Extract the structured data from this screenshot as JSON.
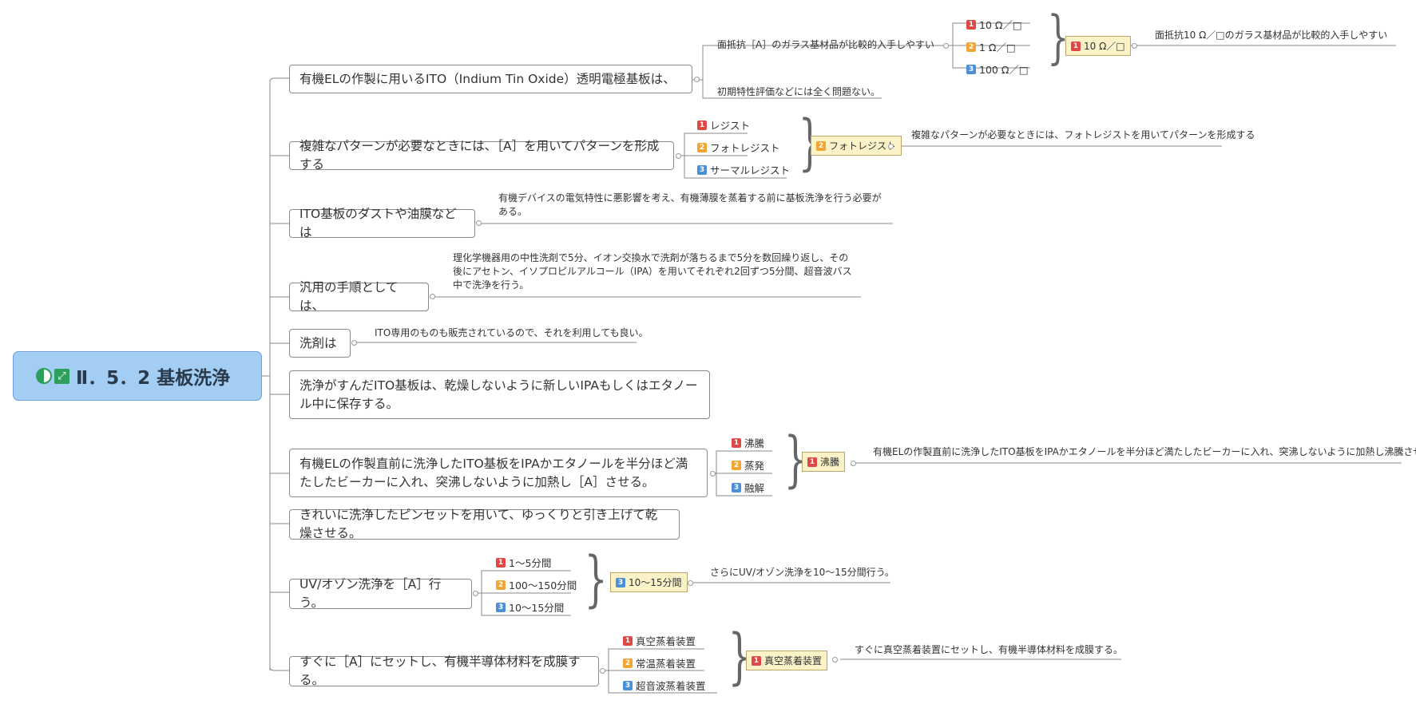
{
  "root": {
    "title": "Ⅱ．5．2 基板洗浄",
    "icon_progress": "half-circle-icon",
    "icon_link": "expand-icon"
  },
  "topics": [
    {
      "text": "有機ELの作製に用いるITO（Indium Tin Oxide）透明電極基板は、",
      "children": [
        {
          "text": "面抵抗［A］のガラス基材品が比較的入手しやすい",
          "options": [
            "10 Ω／□",
            "1 Ω／□",
            "100 Ω／□"
          ],
          "answer": "10 Ω／□",
          "answer_num": "1",
          "explanation": "面抵抗10 Ω／□のガラス基材品が比較的入手しやすい"
        },
        {
          "text": "初期特性評価などには全く問題ない。"
        }
      ]
    },
    {
      "text": "複雑なパターンが必要なときには、［A］を用いてパターンを形成する",
      "options": [
        "レジスト",
        "フォトレジスト",
        "サーマルレジスト"
      ],
      "answer": "フォトレジスト",
      "answer_num": "2",
      "explanation": "複雑なパターンが必要なときには、フォトレジストを用いてパターンを形成する"
    },
    {
      "text": "ITO基板のダストや油膜などは",
      "note": "有機デバイスの電気特性に悪影響を考え、有機薄膜を蒸着する前に基板洗浄を行う必要がある。"
    },
    {
      "text": "汎用の手順としては、",
      "note": "理化学機器用の中性洗剤で5分、イオン交換水で洗剤が落ちるまで5分を数回繰り返し、その後にアセトン、イソプロピルアルコール（IPA）を用いてそれぞれ2回ずつ5分間、超音波バス中で洗浄を行う。"
    },
    {
      "text": "洗剤は",
      "note": "ITO専用のものも販売されているので、それを利用しても良い。"
    },
    {
      "text": "洗浄がすんだITO基板は、乾燥しないように新しいIPAもしくはエタノール中に保存する。"
    },
    {
      "text": "有機ELの作製直前に洗浄したITO基板をIPAかエタノールを半分ほど満たしたビーカーに入れ、突沸しないように加熱し［A］させる。",
      "options": [
        "沸騰",
        "蒸発",
        "融解"
      ],
      "answer": "沸騰",
      "answer_num": "1",
      "explanation": "有機ELの作製直前に洗浄したITO基板をIPAかエタノールを半分ほど満たしたビーカーに入れ、突沸しないように加熱し沸騰させる。"
    },
    {
      "text": "きれいに洗浄したピンセットを用いて、ゆっくりと引き上げて乾燥させる。"
    },
    {
      "text": "UV/オゾン洗浄を［A］行う。",
      "options": [
        "1～5分間",
        "100～150分間",
        "10～15分間"
      ],
      "answer": "10～15分間",
      "answer_num": "3",
      "explanation": "さらにUV/オゾン洗浄を10～15分間行う。"
    },
    {
      "text": "すぐに［A］にセットし、有機半導体材料を成膜する。",
      "options": [
        "真空蒸着装置",
        "常温蒸着装置",
        "超音波蒸着装置"
      ],
      "answer": "真空蒸着装置",
      "answer_num": "1",
      "explanation": "すぐに真空蒸着装置にセットし、有機半導体材料を成膜する。"
    }
  ],
  "option_numbers": [
    "1",
    "2",
    "3"
  ],
  "colors": {
    "root_fill": "#a3cdf3",
    "answer_fill": "#fbf2c8",
    "num1": "#e04848",
    "num2": "#f2a531",
    "num3": "#4b8fd8"
  }
}
